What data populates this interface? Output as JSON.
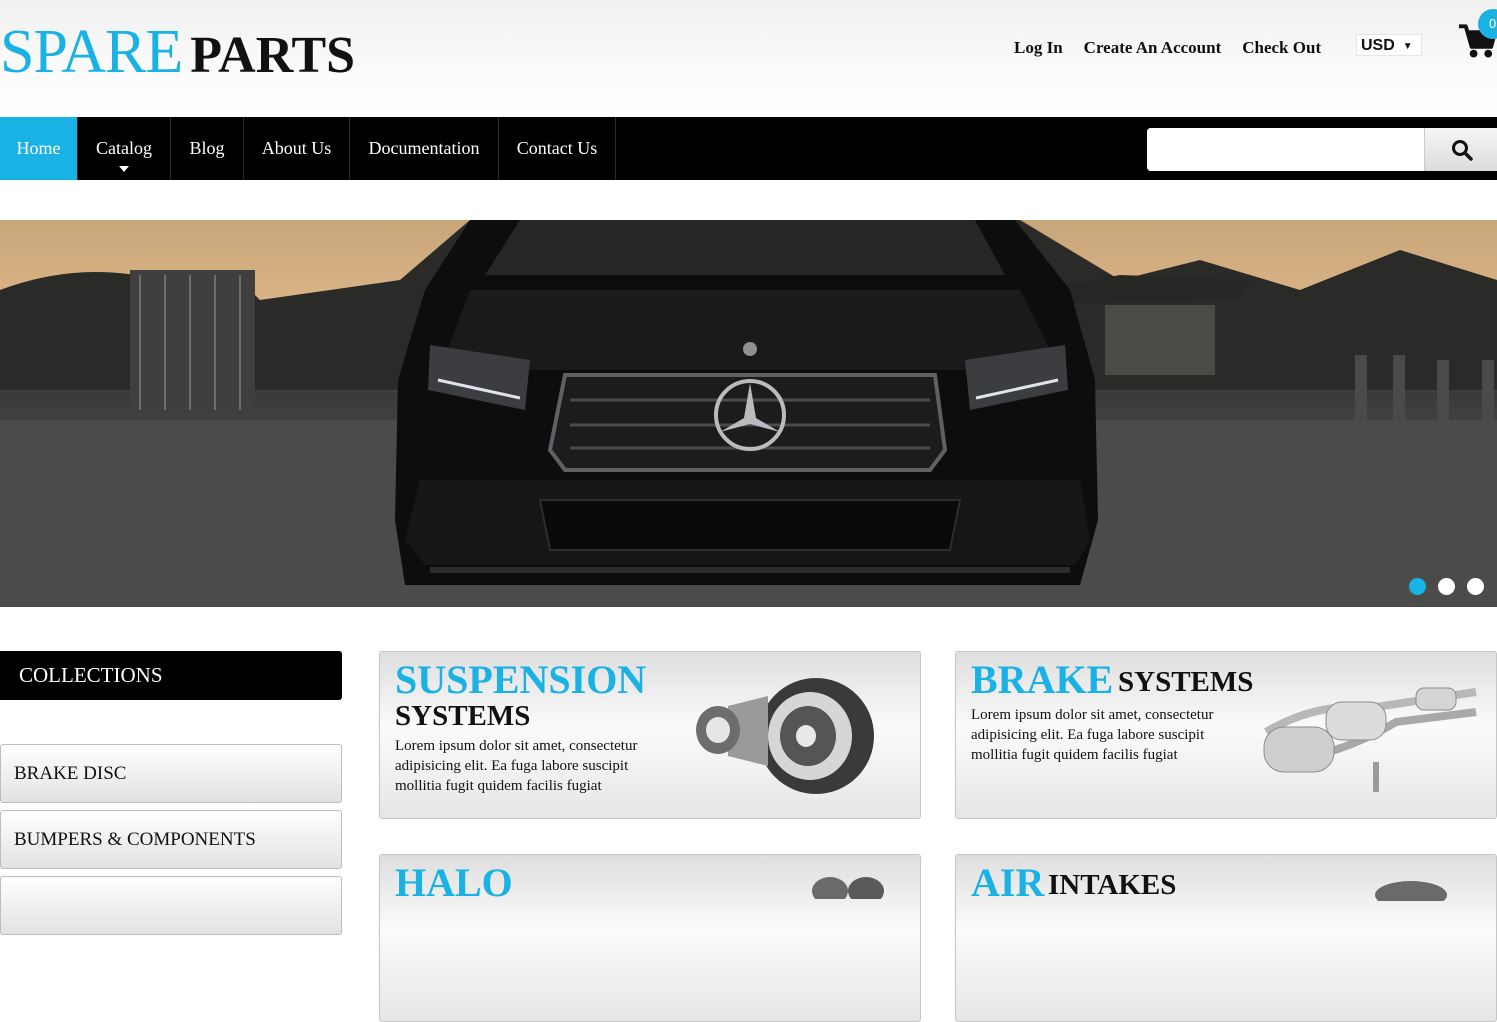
{
  "header": {
    "logo_spare": "SPARE",
    "logo_parts": "PARTS",
    "links": [
      "Log In",
      "Create An Account",
      "Check Out"
    ],
    "currency": "USD",
    "cart_count": "0"
  },
  "nav": {
    "items": [
      {
        "label": "Home",
        "active": true
      },
      {
        "label": "Catalog",
        "dropdown": true
      },
      {
        "label": "Blog"
      },
      {
        "label": "About Us"
      },
      {
        "label": "Documentation"
      },
      {
        "label": "Contact Us"
      }
    ],
    "search_placeholder": ""
  },
  "slider": {
    "image": "black Mercedes-Benz sedan front view at dusk",
    "slides": 3,
    "active_slide": 1
  },
  "sidebar": {
    "heading": "COLLECTIONS",
    "items": [
      "BRAKE DISC",
      "BUMPERS & COMPONENTS"
    ]
  },
  "categories": [
    {
      "title_accent": "SUSPENSION",
      "title_rest": "SYSTEMS",
      "desc": "Lorem ipsum dolor sit amet, consectetur adipisicing elit. Ea fuga labore suscipit mollitia fugit quidem facilis fugiat",
      "image": "turbocharger-icon"
    },
    {
      "title_accent": "BRAKE",
      "title_rest": "SYSTEMS",
      "desc": "Lorem ipsum dolor sit amet, consectetur adipisicing elit. Ea fuga labore suscipit mollitia fugit quidem facilis fugiat",
      "image": "exhaust-muffler-icon"
    },
    {
      "title_accent": "HALO",
      "title_rest": "",
      "desc": "",
      "image": "part-icon"
    },
    {
      "title_accent": "AIR",
      "title_rest": "INTAKES",
      "desc": "",
      "image": "part-icon"
    }
  ],
  "colors": {
    "accent": "#1ab2e4",
    "nav_bg": "#000000"
  }
}
